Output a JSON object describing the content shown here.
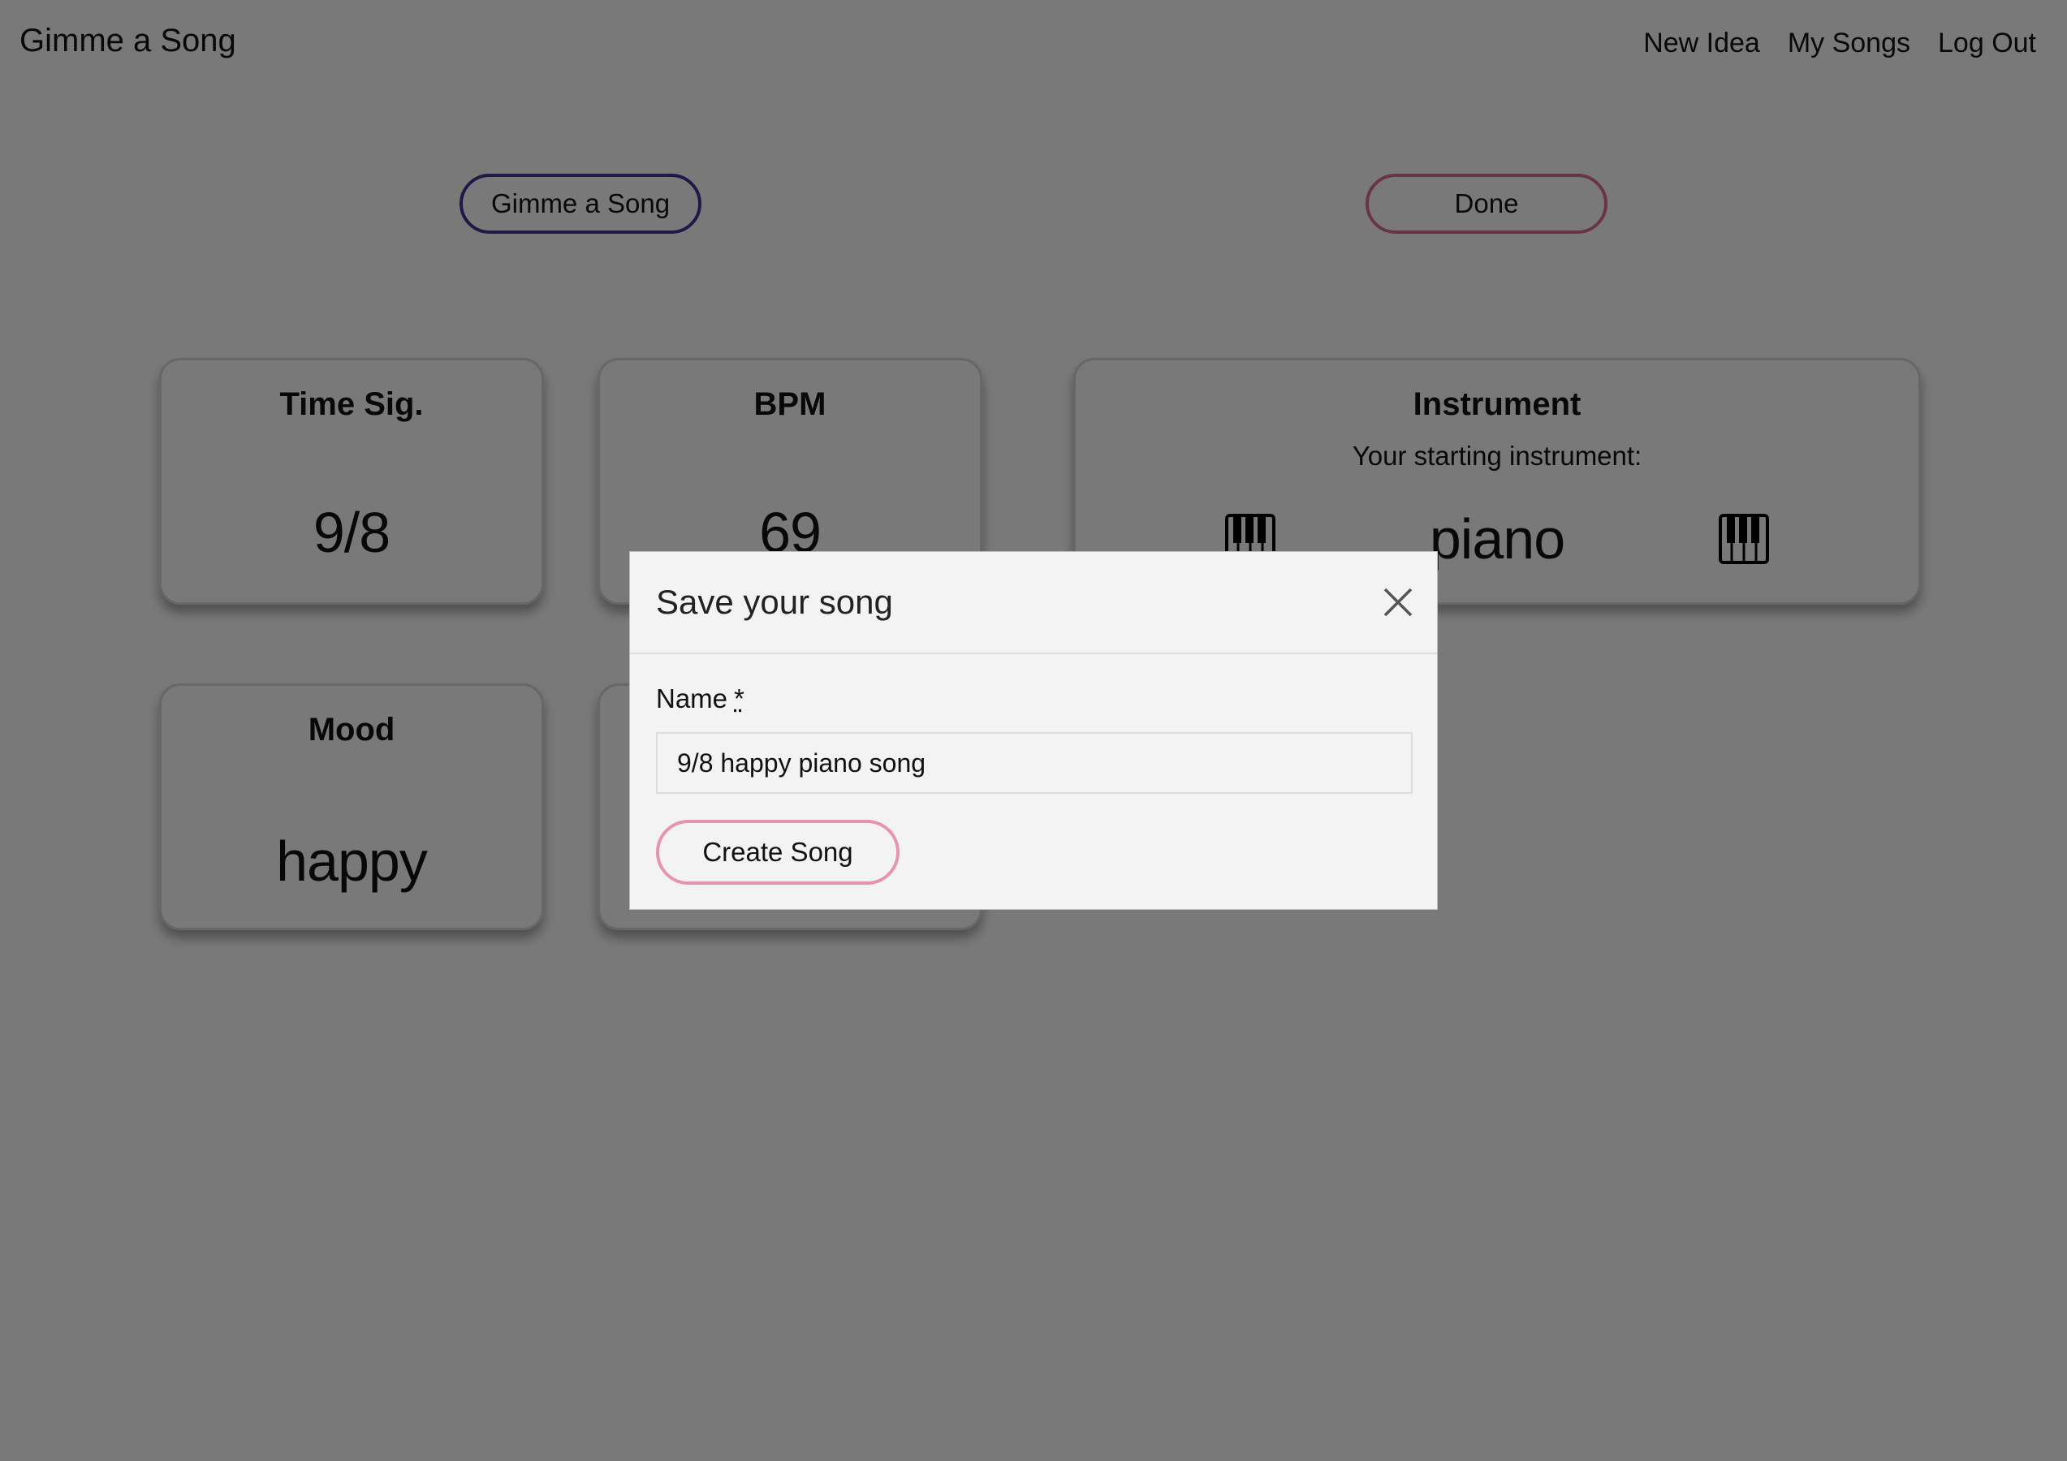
{
  "header": {
    "brand": "Gimme a Song",
    "nav": [
      "New Idea",
      "My Songs",
      "Log Out"
    ]
  },
  "actions": {
    "gimme_label": "Gimme a Song",
    "done_label": "Done"
  },
  "cards": {
    "time_sig": {
      "title": "Time Sig.",
      "value": "9/8"
    },
    "bpm": {
      "title": "BPM",
      "value": "69"
    },
    "instrument": {
      "title": "Instrument",
      "subtitle": "Your starting instrument:",
      "value": "piano",
      "icon": "piano-icon"
    },
    "mood": {
      "title": "Mood",
      "value": "happy"
    }
  },
  "modal": {
    "title": "Save your song",
    "name_label": "Name",
    "required_marker": "*",
    "name_value": "9/8 happy piano song",
    "create_label": "Create Song"
  },
  "colors": {
    "gimme_border": "#3d3590",
    "done_border": "#cf6b8a",
    "create_border": "#e792b0",
    "overlay": "rgba(0,0,0,0.5)"
  }
}
